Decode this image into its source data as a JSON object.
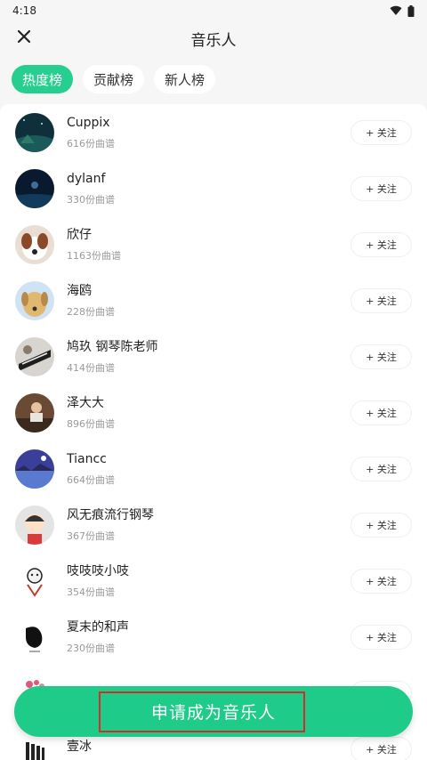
{
  "status_bar": {
    "time": "4:18",
    "icons": [
      "wifi-icon",
      "battery-icon"
    ]
  },
  "header": {
    "title": "音乐人",
    "close_icon": "close-icon"
  },
  "tabs": [
    {
      "label": "热度榜",
      "active": true
    },
    {
      "label": "贡献榜",
      "active": false
    },
    {
      "label": "新人榜",
      "active": false
    }
  ],
  "musicians": [
    {
      "name": "Cuppix",
      "count": "616份曲谱",
      "follow": "+ 关注"
    },
    {
      "name": "dylanf",
      "count": "330份曲谱",
      "follow": "+ 关注"
    },
    {
      "name": "欣仔",
      "count": "1163份曲谱",
      "follow": "+ 关注"
    },
    {
      "name": "海鸥",
      "count": "228份曲谱",
      "follow": "+ 关注"
    },
    {
      "name": "鸠玖 钢琴陈老师",
      "count": "414份曲谱",
      "follow": "+ 关注"
    },
    {
      "name": "泽大大",
      "count": "896份曲谱",
      "follow": "+ 关注"
    },
    {
      "name": "Tiancc",
      "count": "664份曲谱",
      "follow": "+ 关注"
    },
    {
      "name": "风无痕流行钢琴",
      "count": "367份曲谱",
      "follow": "+ 关注"
    },
    {
      "name": "吱吱吱小吱",
      "count": "354份曲谱",
      "follow": "+ 关注"
    },
    {
      "name": "夏末的和声",
      "count": "230份曲谱",
      "follow": "+ 关注"
    },
    {
      "name": "",
      "count": "",
      "follow": "+ 关注"
    },
    {
      "name": "壹冰",
      "count": "",
      "follow": "+ 关注"
    }
  ],
  "apply_button": {
    "label": "申请成为音乐人"
  },
  "colors": {
    "accent": "#1ecb88",
    "highlight_frame": "#d62b2b"
  }
}
